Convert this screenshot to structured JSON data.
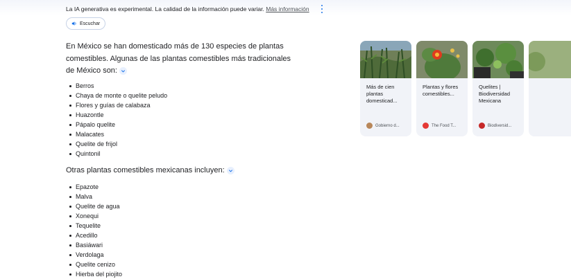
{
  "header": {
    "disclaimer": "La IA generativa es experimental. La calidad de la información puede variar.",
    "more_info_link": "Más información",
    "listen_button": "Escuchar"
  },
  "intro": {
    "text": "En México se han domesticado más de 130 especies de plantas comestibles. Algunas de las plantas comestibles más tradicionales de México son:"
  },
  "list1": [
    "Berros",
    "Chaya de monte o quelite peludo",
    "Flores y guías de calabaza",
    "Huazontle",
    "Pápalo quelite",
    "Malacates",
    "Quelite de frijol",
    "Quintonil"
  ],
  "subheading": "Otras plantas comestibles mexicanas incluyen:",
  "list2": [
    "Epazote",
    "Malva",
    "Quelite de agua",
    "Xonequi",
    "Tequelite",
    "Acedillo",
    "Basiáwari",
    "Verdolaga",
    "Quelite cenizo",
    "Hierba del piojito"
  ],
  "cards": [
    {
      "title": "Más de cien plantas domesticad...",
      "source": "Gobierno d...",
      "favicon_color": "#b8875a"
    },
    {
      "title": "Plantas y flores comestibles...",
      "source": "The Food T...",
      "favicon_color": "#e53935"
    },
    {
      "title": "Quelites | Biodiversidad Mexicana",
      "source": "Biodiversid...",
      "favicon_color": "#c62828"
    }
  ],
  "icons": {
    "menu": "more-vert-icon",
    "listen": "speaker-icon",
    "expand": "chevron-down-icon"
  },
  "colors": {
    "accent": "#1a73e8",
    "card_bg": "#f1f3f8",
    "text": "#202124"
  }
}
